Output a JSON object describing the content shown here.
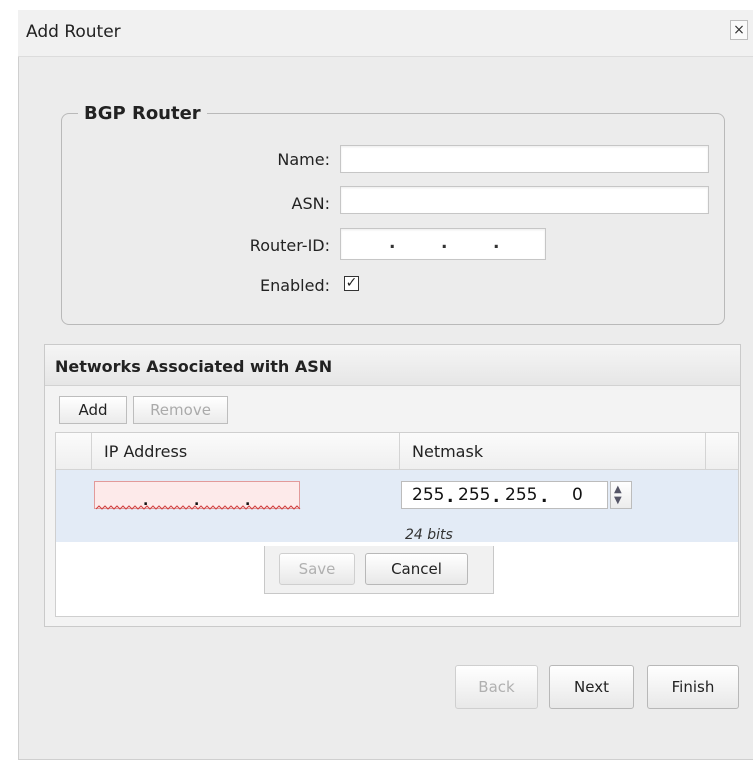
{
  "dialog": {
    "title": "Add Router",
    "close_icon": "close-icon"
  },
  "bgp": {
    "legend": "BGP Router",
    "name_label": "Name:",
    "name_value": "",
    "asn_label": "ASN:",
    "asn_value": "",
    "router_id_label": "Router-ID:",
    "router_id_value": "",
    "enabled_label": "Enabled:",
    "enabled_checked": true,
    "enabled_mark": "✓"
  },
  "networks": {
    "title": "Networks Associated with ASN",
    "add_label": "Add",
    "remove_label": "Remove",
    "columns": [
      "IP Address",
      "Netmask"
    ],
    "edit_row": {
      "ip_address": "",
      "netmask": [
        "255",
        "255",
        "255",
        "0"
      ],
      "bits_label": "24 bits"
    },
    "save_label": "Save",
    "cancel_label": "Cancel"
  },
  "footer": {
    "back_label": "Back",
    "next_label": "Next",
    "finish_label": "Finish"
  },
  "colors": {
    "dialog_bg": "#ececec",
    "edit_row_bg": "#e3ebf6",
    "invalid_bg": "#fdeaea",
    "invalid_border": "#e29a9a"
  }
}
